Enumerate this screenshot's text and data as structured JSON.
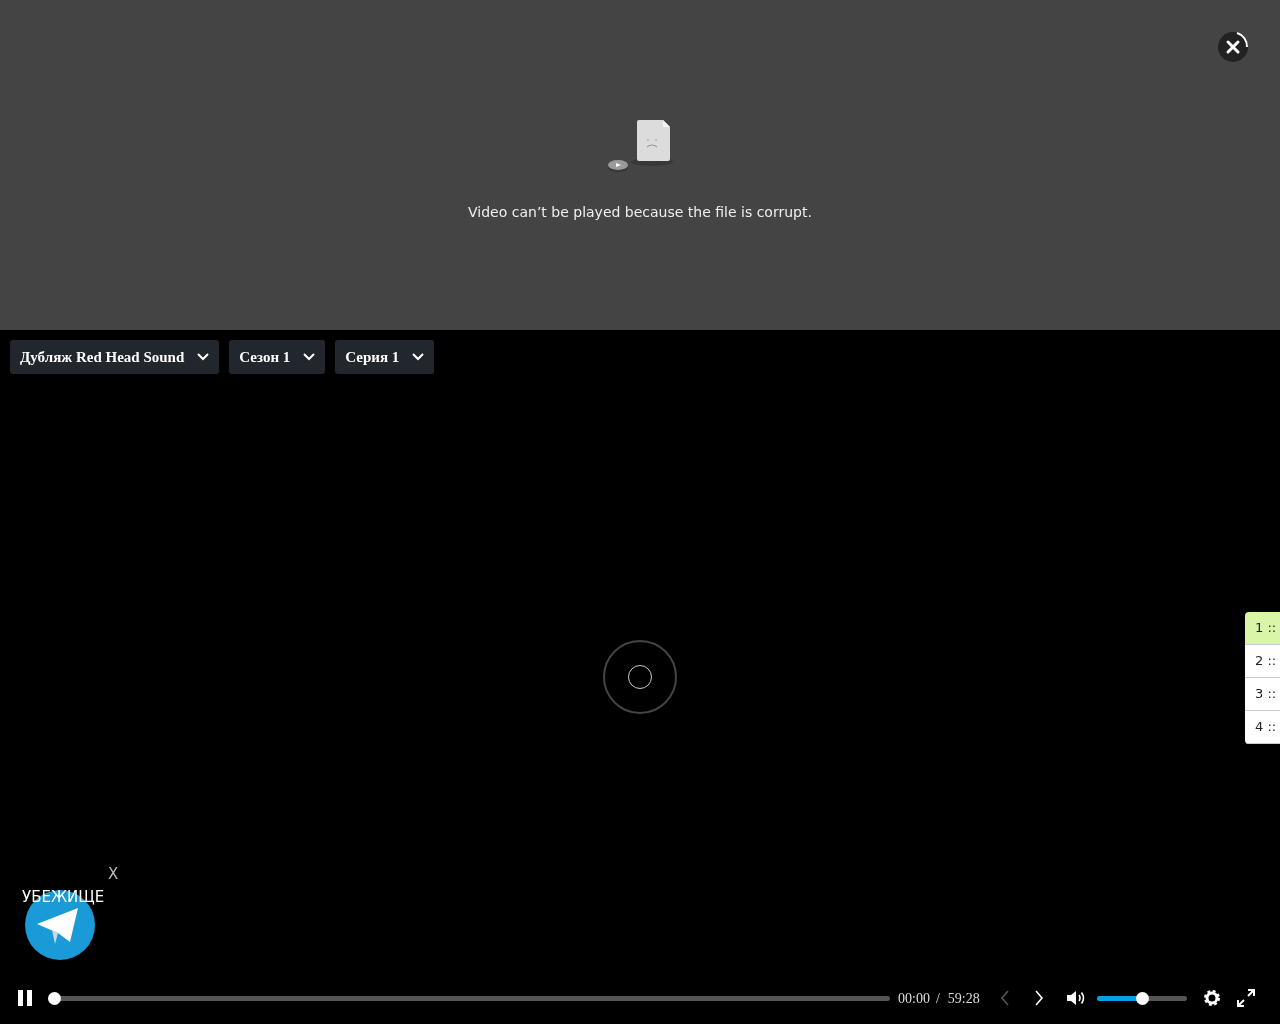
{
  "error_panel": {
    "message": "Video can’t be played because the file is corrupt."
  },
  "dropdowns": [
    {
      "label": "Дубляж Red Head Sound"
    },
    {
      "label": "Сезон 1"
    },
    {
      "label": "Серия 1"
    }
  ],
  "side_list": [
    {
      "label": "1 ::",
      "selected": true
    },
    {
      "label": "2 ::",
      "selected": false
    },
    {
      "label": "3 ::",
      "selected": false
    },
    {
      "label": "4 ::",
      "selected": false
    }
  ],
  "promo": {
    "label": "УБЕЖИЩЕ",
    "close": "X"
  },
  "controls": {
    "progress": {
      "level": 0.0
    },
    "current_time": "00:00",
    "separator": "/",
    "duration": "59:28",
    "prev_disabled": true,
    "next_disabled": false,
    "volume": {
      "level": 0.5
    }
  }
}
